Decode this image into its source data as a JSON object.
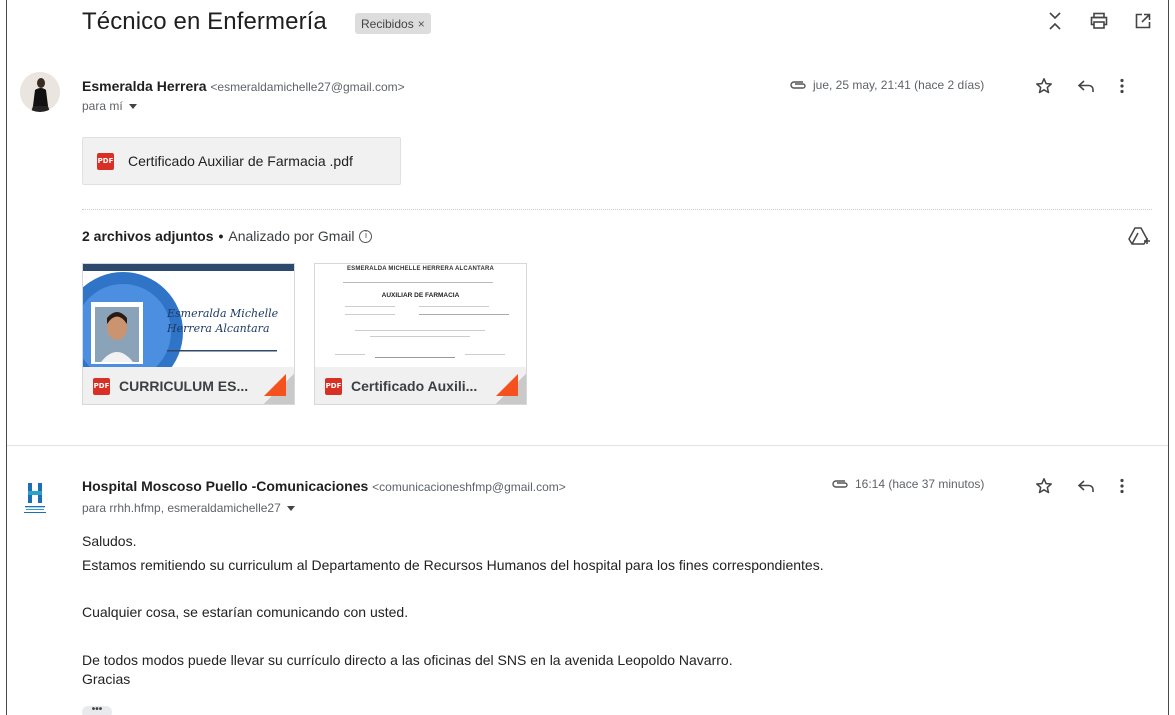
{
  "thread": {
    "subject": "Técnico en Enfermería",
    "label": "Recibidos",
    "label_remove": "×"
  },
  "message1": {
    "sender_name": "Esmeralda Herrera",
    "sender_email": "<esmeraldamichelle27@gmail.com>",
    "recipients": "para mí",
    "date": "jue, 25 may, 21:41 (hace 2 días)",
    "inline_attachment": "Certificado Auxiliar de Farmacia .pdf",
    "attachments_count": "2 archivos adjuntos",
    "attachments_sep": "•",
    "scanned_by": "Analizado por Gmail",
    "attachments": [
      {
        "name": "CURRICULUM ES...",
        "preview_name": "Esmeralda Michelle Herrera Alcantara"
      },
      {
        "name": "Certificado Auxili...",
        "preview_title": "ESMERALDA MICHELLE HERRERA ALCANTARA",
        "preview_subtitle": "AUXILIAR DE FARMACIA"
      }
    ]
  },
  "message2": {
    "sender_name": "Hospital Moscoso Puello -Comunicaciones",
    "sender_email": "<comunicacioneshfmp@gmail.com>",
    "recipients": "para rrhh.hfmp, esmeraldamichelle27",
    "date": "16:14 (hace 37 minutos)",
    "body": {
      "line1": "Saludos.",
      "line2": "Estamos remitiendo su curriculum al Departamento de Recursos Humanos del hospital para los fines correspondientes.",
      "line3": "Cualquier cosa, se estarían comunicando con usted.",
      "line4": "De todos modos puede llevar su currículo directo a las oficinas del SNS en la avenida Leopoldo Navarro.",
      "line5": "Gracias"
    },
    "more": "•••"
  },
  "icons": {
    "pdf_badge": "PDF",
    "info": "i"
  },
  "colors": {
    "pdf_red": "#d93025",
    "corner_orange": "#f4511e",
    "chip_bg": "#dddddd",
    "hospital_blue": "#1a6fb5"
  }
}
